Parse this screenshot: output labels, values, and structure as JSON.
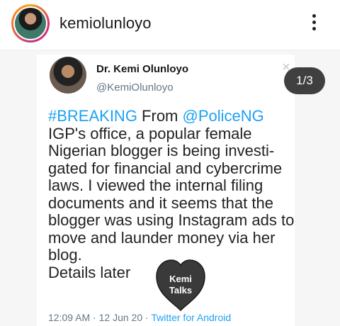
{
  "post_header": {
    "username": "kemiolunloyo",
    "avatar_icon": "profile-avatar",
    "more_icon": "vertical-ellipsis-icon"
  },
  "carousel": {
    "counter": "1/3"
  },
  "tweet": {
    "author_name": "Dr. Kemi Olunloyo",
    "handle": "@KemiOlunloyo",
    "close_glyph": "×",
    "hashtag": "#BREAKING",
    "from_text": " From ",
    "mention": "@PoliceNG",
    "body": " IGP's office, a popular female Nigerian blogger is being investi-gated for financial and cybercrime laws. I viewed the internal filing documents and it seems that the blogger was using Instagram ads to move and launder money via her blog.",
    "closing": "Details later",
    "time": "12:09 AM",
    "separator": " · ",
    "date": "12 Jun 20",
    "source": "Twitter for Android"
  },
  "watermark": {
    "line1": "Kemi",
    "line2": "Talks"
  },
  "colors": {
    "link": "#1da1f2",
    "muted": "#657786"
  }
}
